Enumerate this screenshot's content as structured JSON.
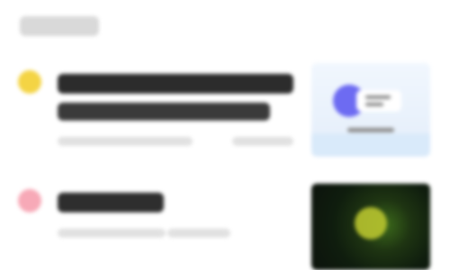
{
  "header": {
    "section_title": ""
  },
  "cards": [
    {
      "title_line1": "",
      "title_line2": "",
      "meta_left": "",
      "meta_right": "",
      "accent_color": "#f4d444"
    },
    {
      "title_line1": "",
      "meta_left": "",
      "meta_right": "",
      "accent_color": "#f7a9b7"
    }
  ],
  "icons": {
    "card1": "info-dot-icon",
    "card2": "alert-dot-icon"
  }
}
